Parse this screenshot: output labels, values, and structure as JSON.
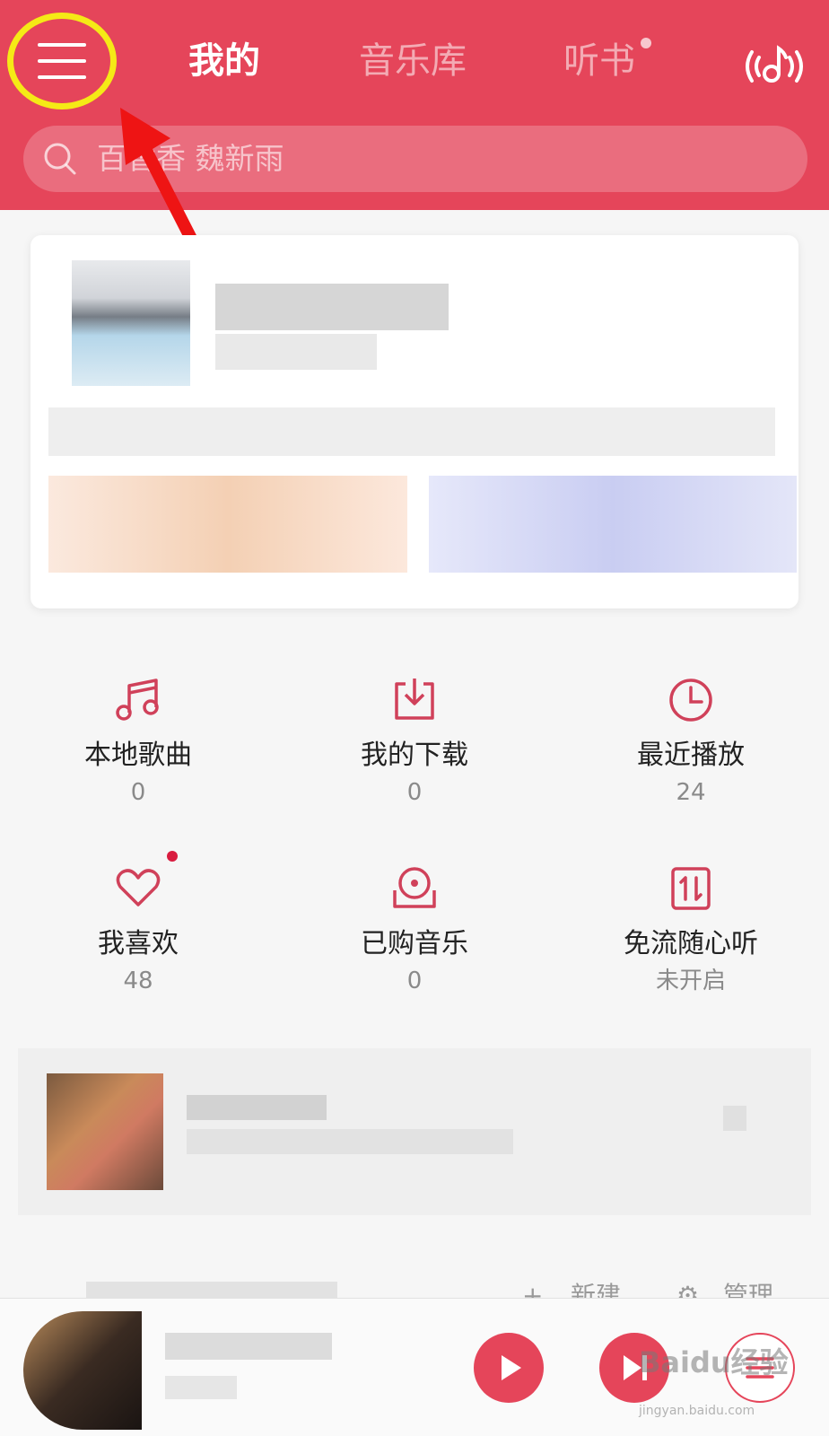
{
  "header": {
    "tabs": [
      {
        "label": "我的",
        "active": true
      },
      {
        "label": "音乐库",
        "active": false
      },
      {
        "label": "听书",
        "active": false
      }
    ],
    "search_placeholder": "百香香 魏新雨",
    "accent_color": "#e5455a",
    "highlight_color": "#f5ea16",
    "icons": [
      "menu-icon",
      "listen-recognition-icon",
      "search-icon"
    ]
  },
  "grid": [
    {
      "label": "本地歌曲",
      "count": "0",
      "icon": "music-note-icon"
    },
    {
      "label": "我的下载",
      "count": "0",
      "icon": "download-icon"
    },
    {
      "label": "最近播放",
      "count": "24",
      "icon": "clock-icon"
    },
    {
      "label": "我喜欢",
      "count": "48",
      "icon": "heart-icon"
    },
    {
      "label": "已购音乐",
      "count": "0",
      "icon": "purchased-disc-icon"
    },
    {
      "label": "免流随心听",
      "count": "未开启",
      "icon": "data-free-icon"
    }
  ],
  "section": {
    "new_label": "新建",
    "manage_label": "管理"
  },
  "player": {
    "icons": [
      "play-icon",
      "next-track-icon",
      "playlist-icon"
    ]
  },
  "watermark": {
    "text": "Baidu经验",
    "url": "jingyan.baidu.com"
  }
}
